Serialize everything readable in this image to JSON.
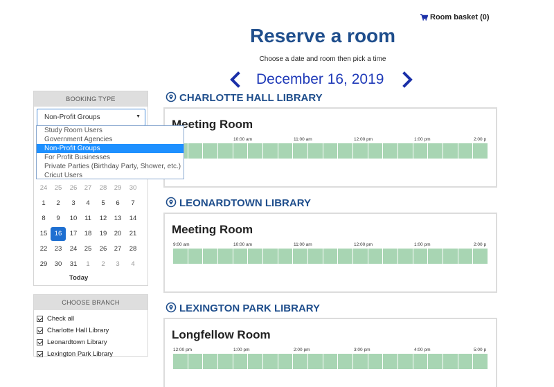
{
  "header": {
    "basket_label": "Room basket (0)",
    "title": "Reserve a room",
    "subtitle": "Choose a date and room then pick a time",
    "date": "December 16, 2019"
  },
  "sidebar": {
    "booking_type": {
      "heading": "BOOKING TYPE",
      "selected": "Non-Profit Groups",
      "options": [
        "Study Room Users",
        "Government Agencies",
        "Non-Profit Groups",
        "For Profit Businesses",
        "Private Parties (Birthday Party, Shower, etc.)",
        "Cricut Users"
      ]
    },
    "calendar": {
      "weeks": [
        [
          "24",
          "25",
          "26",
          "27",
          "28",
          "29",
          "30"
        ],
        [
          "1",
          "2",
          "3",
          "4",
          "5",
          "6",
          "7"
        ],
        [
          "8",
          "9",
          "10",
          "11",
          "12",
          "13",
          "14"
        ],
        [
          "15",
          "16",
          "17",
          "18",
          "19",
          "20",
          "21"
        ],
        [
          "22",
          "23",
          "24",
          "25",
          "26",
          "27",
          "28"
        ],
        [
          "29",
          "30",
          "31",
          "1",
          "2",
          "3",
          "4"
        ]
      ],
      "selected_day": "16",
      "today_label": "Today"
    },
    "branch": {
      "heading": "CHOOSE BRANCH",
      "items": [
        "Check all",
        "Charlotte Hall Library",
        "Leonardtown Library",
        "Lexington Park Library"
      ]
    }
  },
  "libraries": [
    {
      "name": "CHARLOTTE HALL LIBRARY",
      "room": "Meeting Room",
      "times": [
        "am",
        "10:00 am",
        "11:00 am",
        "12:00 pm",
        "1:00 pm",
        "2:00 p"
      ]
    },
    {
      "name": "LEONARDTOWN LIBRARY",
      "room": "Meeting Room",
      "times": [
        "9:00 am",
        "10:00 am",
        "11:00 am",
        "12:00 pm",
        "1:00 pm",
        "2:00 p"
      ]
    },
    {
      "name": "LEXINGTON PARK LIBRARY",
      "room": "Longfellow Room",
      "times": [
        "12:00 pm",
        "1:00 pm",
        "2:00 pm",
        "3:00 pm",
        "4:00 pm",
        "5:00 p"
      ]
    }
  ],
  "colors": {
    "title_blue": "#1f4e8c",
    "date_blue": "#1f3ab8",
    "slot_green": "#a8d5b3",
    "selected_blue": "#1e90ff"
  }
}
